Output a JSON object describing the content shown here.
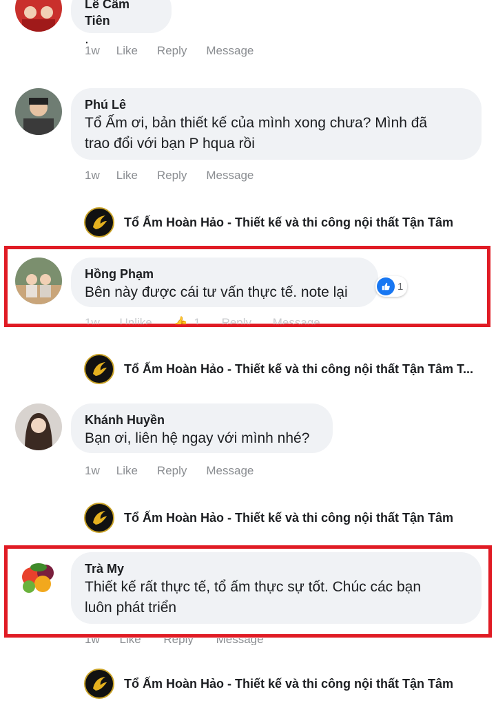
{
  "colors": {
    "bubble": "#f0f2f5",
    "meta": "#8a8d91",
    "highlight": "#e01b24",
    "like_blue": "#1877f2"
  },
  "comments": [
    {
      "name": "Lê Cẩm Tiên",
      "text": ".",
      "time": "1w",
      "like": "Like",
      "reply": "Reply",
      "message": "Message"
    },
    {
      "name": "Phú Lê",
      "text_line1": "Tổ Ấm ơi, bản thiết kế của mình xong chưa? Mình đã",
      "text_line2": "trao đổi với bạn P hqua rồi",
      "time": "1w",
      "like": "Like",
      "reply": "Reply",
      "message": "Message"
    },
    {
      "name": "Hồng Phạm",
      "text": "Bên này được cái tư vấn thực tế. note lại",
      "reaction_count": "1",
      "time": "1w",
      "like": "Unlike",
      "like_count": "1",
      "reply": "Reply",
      "message": "Message"
    },
    {
      "name": "Khánh Huyền",
      "text": "Bạn ơi, liên hệ ngay với mình nhé?",
      "time": "1w",
      "like": "Like",
      "reply": "Reply",
      "message": "Message"
    },
    {
      "name": "Trà My",
      "text_line1": "Thiết kế rất thực tế, tổ ấm thực sự tốt. Chúc các bạn",
      "text_line2": "luôn phát triển",
      "time": "1w",
      "like": "Like",
      "reply": "Reply",
      "message": "Message"
    }
  ],
  "page_replies": [
    {
      "name": "Tổ Ấm Hoàn Hảo - Thiết kế và thi công nội thất Tận Tâm"
    },
    {
      "name": "Tổ Ấm Hoàn Hảo - Thiết kế và thi công nội thất Tận Tâm  T..."
    },
    {
      "name": "Tổ Ấm Hoàn Hảo - Thiết kế và thi công nội thất Tận Tâm"
    },
    {
      "name": "Tổ Ấm Hoàn Hảo - Thiết kế và thi công nội thất Tận Tâm"
    }
  ],
  "icons": {
    "avatar": "avatar",
    "page_logo": "phoenix-logo-icon",
    "like": "thumbs-up-icon"
  }
}
